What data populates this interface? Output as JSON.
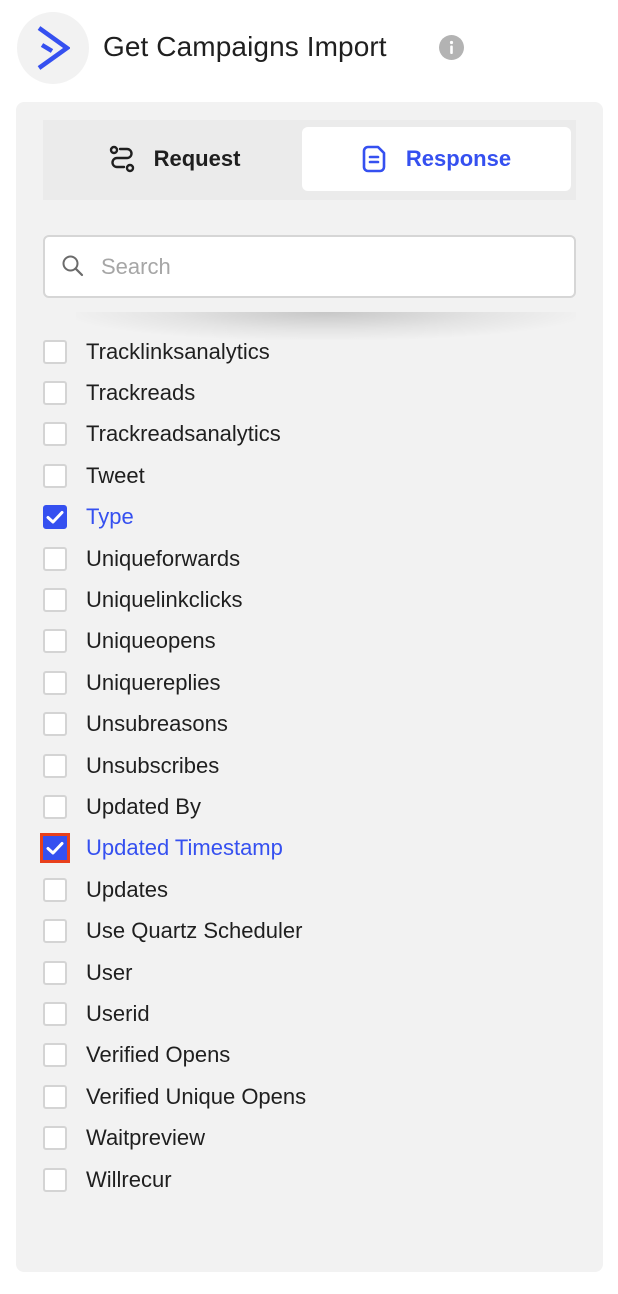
{
  "header": {
    "title": "Get Campaigns Import",
    "logo_icon": "activecampaign-chevron-logo",
    "info_icon": "info-icon"
  },
  "tabs": [
    {
      "label": "Request",
      "icon": "route-icon",
      "active": false
    },
    {
      "label": "Response",
      "icon": "document-icon",
      "active": true
    }
  ],
  "search": {
    "placeholder": "Search",
    "value": ""
  },
  "fields": [
    {
      "label": "Tracklinksanalytics",
      "checked": false
    },
    {
      "label": "Trackreads",
      "checked": false
    },
    {
      "label": "Trackreadsanalytics",
      "checked": false
    },
    {
      "label": "Tweet",
      "checked": false
    },
    {
      "label": "Type",
      "checked": true
    },
    {
      "label": "Uniqueforwards",
      "checked": false
    },
    {
      "label": "Uniquelinkclicks",
      "checked": false
    },
    {
      "label": "Uniqueopens",
      "checked": false
    },
    {
      "label": "Uniquereplies",
      "checked": false
    },
    {
      "label": "Unsubreasons",
      "checked": false
    },
    {
      "label": "Unsubscribes",
      "checked": false
    },
    {
      "label": "Updated By",
      "checked": false
    },
    {
      "label": "Updated Timestamp",
      "checked": true,
      "highlighted": true
    },
    {
      "label": "Updates",
      "checked": false
    },
    {
      "label": "Use Quartz Scheduler",
      "checked": false
    },
    {
      "label": "User",
      "checked": false
    },
    {
      "label": "Userid",
      "checked": false
    },
    {
      "label": "Verified Opens",
      "checked": false
    },
    {
      "label": "Verified Unique Opens",
      "checked": false
    },
    {
      "label": "Waitpreview",
      "checked": false
    },
    {
      "label": "Willrecur",
      "checked": false
    }
  ],
  "colors": {
    "accent": "#3550f0",
    "highlight_outline": "#e8401c",
    "panel_bg": "#f2f2f2"
  }
}
